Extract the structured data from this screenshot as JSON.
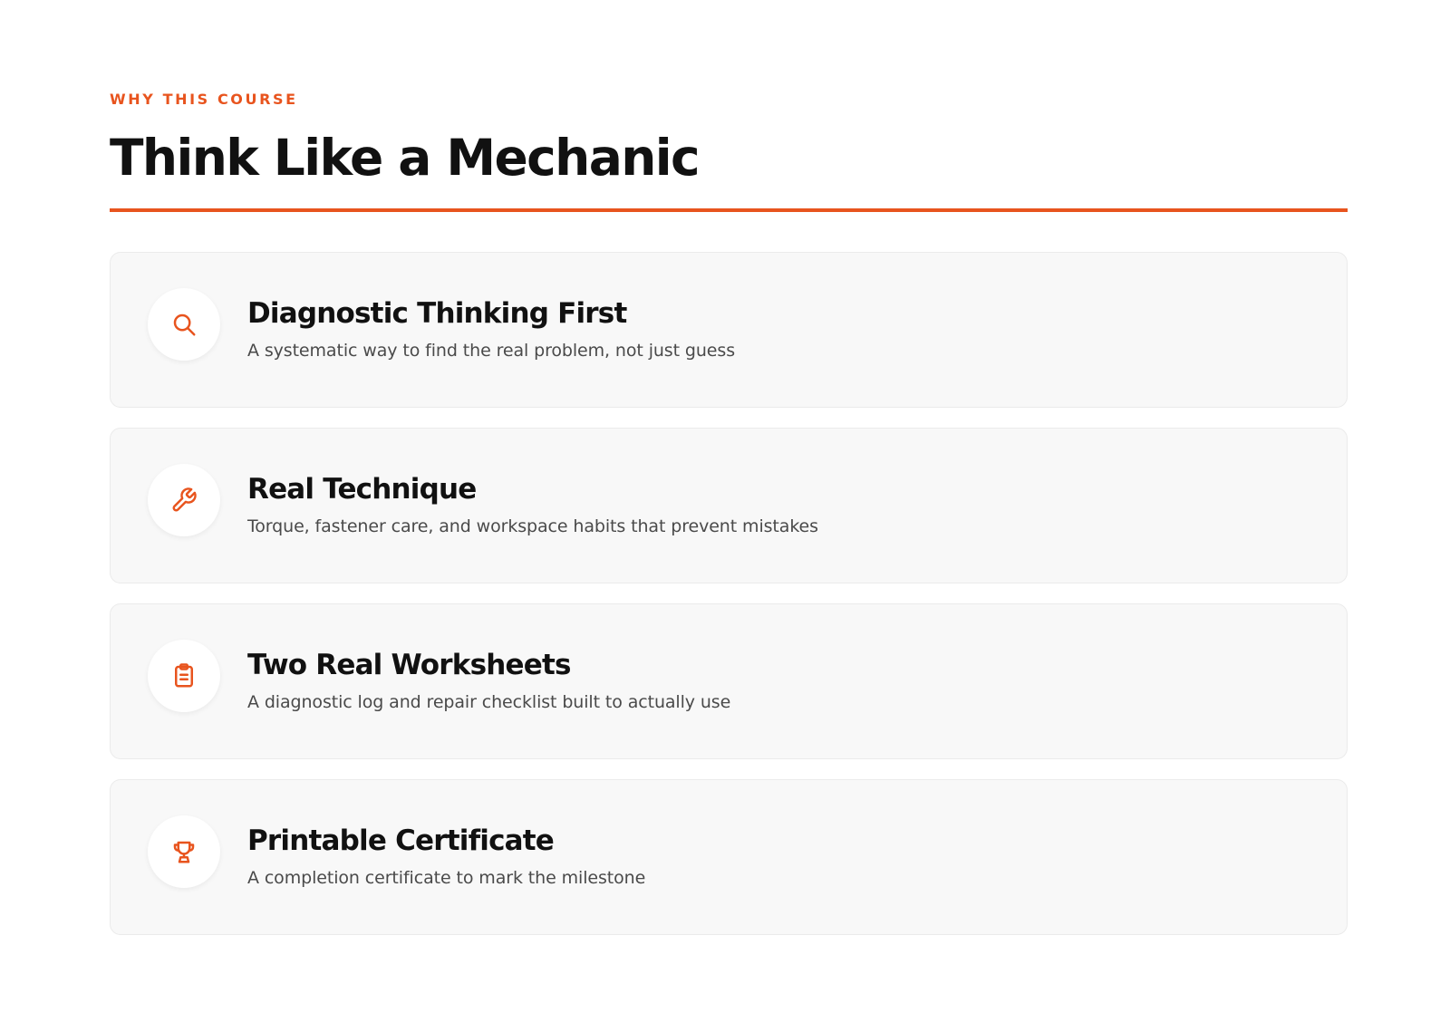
{
  "section": {
    "eyebrow": "WHY THIS COURSE",
    "title": "Think Like a Mechanic"
  },
  "colors": {
    "accent": "#e8541e",
    "heading": "#111111",
    "body_text": "#4a4a4a",
    "card_background": "#f8f8f8"
  },
  "features": [
    {
      "icon": "search-icon",
      "title": "Diagnostic Thinking First",
      "description": "A systematic way to find the real problem, not just guess"
    },
    {
      "icon": "wrench-icon",
      "title": "Real Technique",
      "description": "Torque, fastener care, and workspace habits that prevent mistakes"
    },
    {
      "icon": "clipboard-icon",
      "title": "Two Real Worksheets",
      "description": "A diagnostic log and repair checklist built to actually use"
    },
    {
      "icon": "trophy-icon",
      "title": "Printable Certificate",
      "description": "A completion certificate to mark the milestone"
    }
  ]
}
